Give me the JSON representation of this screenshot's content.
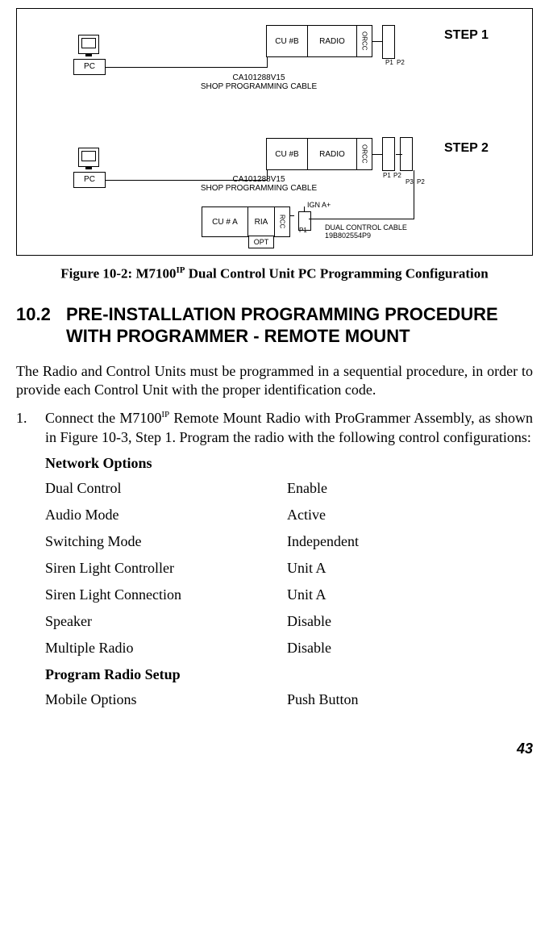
{
  "diagram": {
    "step1_label": "STEP 1",
    "step2_label": "STEP 2",
    "pc_label": "PC",
    "cu_b": "CU #B",
    "radio": "RADIO",
    "orcc": "ORCC",
    "p1": "P1",
    "p2": "P2",
    "p3": "P3",
    "cable_code": "CA101288V15",
    "cable_name": "SHOP PROGRAMMING CABLE",
    "cu_a": "CU # A",
    "ria": "RIA",
    "rcc": "RCC",
    "opt": "OPT",
    "ign": "IGN A+",
    "dual_cable": "DUAL CONTROL CABLE",
    "dual_cable_code": "19B802554P9"
  },
  "figure_caption": {
    "prefix": "Figure 10-2: M7100",
    "sup": "IP",
    "suffix": " Dual Control Unit PC Programming Configuration"
  },
  "section": {
    "number": "10.2",
    "title": "PRE-INSTALLATION PROGRAMMING PROCEDURE WITH PROGRAMMER - REMOTE MOUNT"
  },
  "intro": "The Radio and Control Units must be programmed in a sequential procedure, in order to provide each Control Unit with the proper identification code.",
  "list_item_1": {
    "num": "1.",
    "text_before_sup": "Connect the M7100",
    "sup": "IP",
    "text_after_sup": " Remote Mount Radio with ProGrammer Assembly, as shown in Figure 10-3, Step 1. Program the radio with the following control configurations:"
  },
  "subhead_network": "Network Options",
  "options_network": [
    {
      "label": "Dual Control",
      "value": "Enable"
    },
    {
      "label": "Audio Mode",
      "value": "Active"
    },
    {
      "label": "Switching Mode",
      "value": "Independent"
    },
    {
      "label": "Siren Light Controller",
      "value": "Unit A"
    },
    {
      "label": "Siren Light Connection",
      "value": "Unit A"
    },
    {
      "label": "Speaker",
      "value": "Disable"
    },
    {
      "label": "Multiple Radio",
      "value": "Disable"
    }
  ],
  "subhead_radio": "Program Radio Setup",
  "options_radio": [
    {
      "label": "Mobile Options",
      "value": "Push Button"
    }
  ],
  "page_number": "43"
}
